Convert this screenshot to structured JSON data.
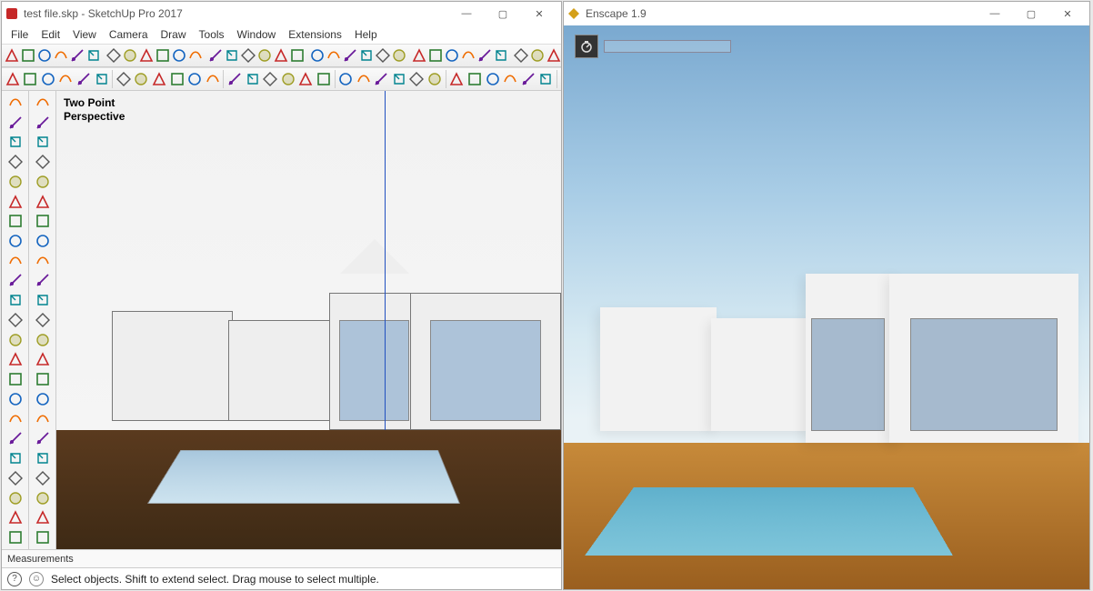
{
  "sketchup": {
    "title": "test file.skp - SketchUp Pro 2017",
    "menu": [
      "File",
      "Edit",
      "View",
      "Camera",
      "Draw",
      "Tools",
      "Window",
      "Extensions",
      "Help"
    ],
    "viewport_label_line1": "Two Point",
    "viewport_label_line2": "Perspective",
    "measurements_label": "Measurements",
    "status_hint": "Select objects. Shift to extend select. Drag mouse to select multiple.",
    "window_controls": {
      "minimize": "—",
      "maximize": "▢",
      "close": "✕"
    },
    "toolbar_top1": [
      "select",
      "eraser",
      "pencil",
      "arc",
      "tape",
      "pushpull",
      "move",
      "rotate",
      "offset",
      "scale",
      "paint",
      "orbit",
      "pan",
      "zoom",
      "walk",
      "section",
      "dim",
      "text",
      "label",
      "3dtext",
      "protractor",
      "axes",
      "mirror",
      "poly",
      "geo",
      "photo",
      "solid",
      "dwg",
      "export",
      "print",
      "sandbox",
      "layers",
      "warehouse",
      "shadows",
      "fog",
      "plugin-a",
      "plugin-b",
      "zoom-ext",
      "zoom-win",
      "prev",
      "next",
      "styles",
      "entity"
    ],
    "toolbar_top2": [
      "newfile",
      "open",
      "save",
      "undo",
      "redo",
      "refresh",
      "print",
      "cut",
      "copy",
      "paste",
      "run",
      "terminal",
      "upload",
      "download",
      "send",
      "img",
      "render",
      "settings",
      "bulb",
      "plugin1",
      "plugin2",
      "plugin3",
      "plugin4",
      "plugin5",
      "plugin6",
      "plugin7",
      "plugin8",
      "cart",
      "info",
      "cursor"
    ],
    "tool_col_left": [
      "select",
      "lasso",
      "eraser",
      "paint",
      "pencil",
      "freehand",
      "rect",
      "circle",
      "arc",
      "2pt-arc",
      "pie",
      "polygon",
      "move",
      "rotate",
      "scale",
      "offset",
      "pushpull",
      "followme",
      "tape",
      "protractor",
      "text",
      "dim",
      "axes",
      "section",
      "orbit",
      "pan",
      "zoom",
      "zoom-ext",
      "position",
      "walk",
      "look"
    ],
    "tool_col_left2": [
      "component",
      "group",
      "outliner",
      "materials",
      "styles",
      "scenes",
      "shadows",
      "fog",
      "layers",
      "entity",
      "soften",
      "tag",
      "model",
      "match",
      "photo",
      "geo",
      "sandbox",
      "solid",
      "export",
      "import",
      "printset",
      "preferences",
      "pluginA",
      "pluginB",
      "eye",
      "eye2",
      "foot",
      "foot2",
      "dot"
    ]
  },
  "enscape": {
    "title": "Enscape 1.9",
    "window_controls": {
      "minimize": "—",
      "maximize": "▢",
      "close": "✕"
    }
  },
  "icons": {
    "su": "S",
    "en": "◆"
  },
  "colors": {
    "su_red": "#c62828",
    "en_gold": "#d4a019",
    "axis_blue": "#2050c0"
  }
}
